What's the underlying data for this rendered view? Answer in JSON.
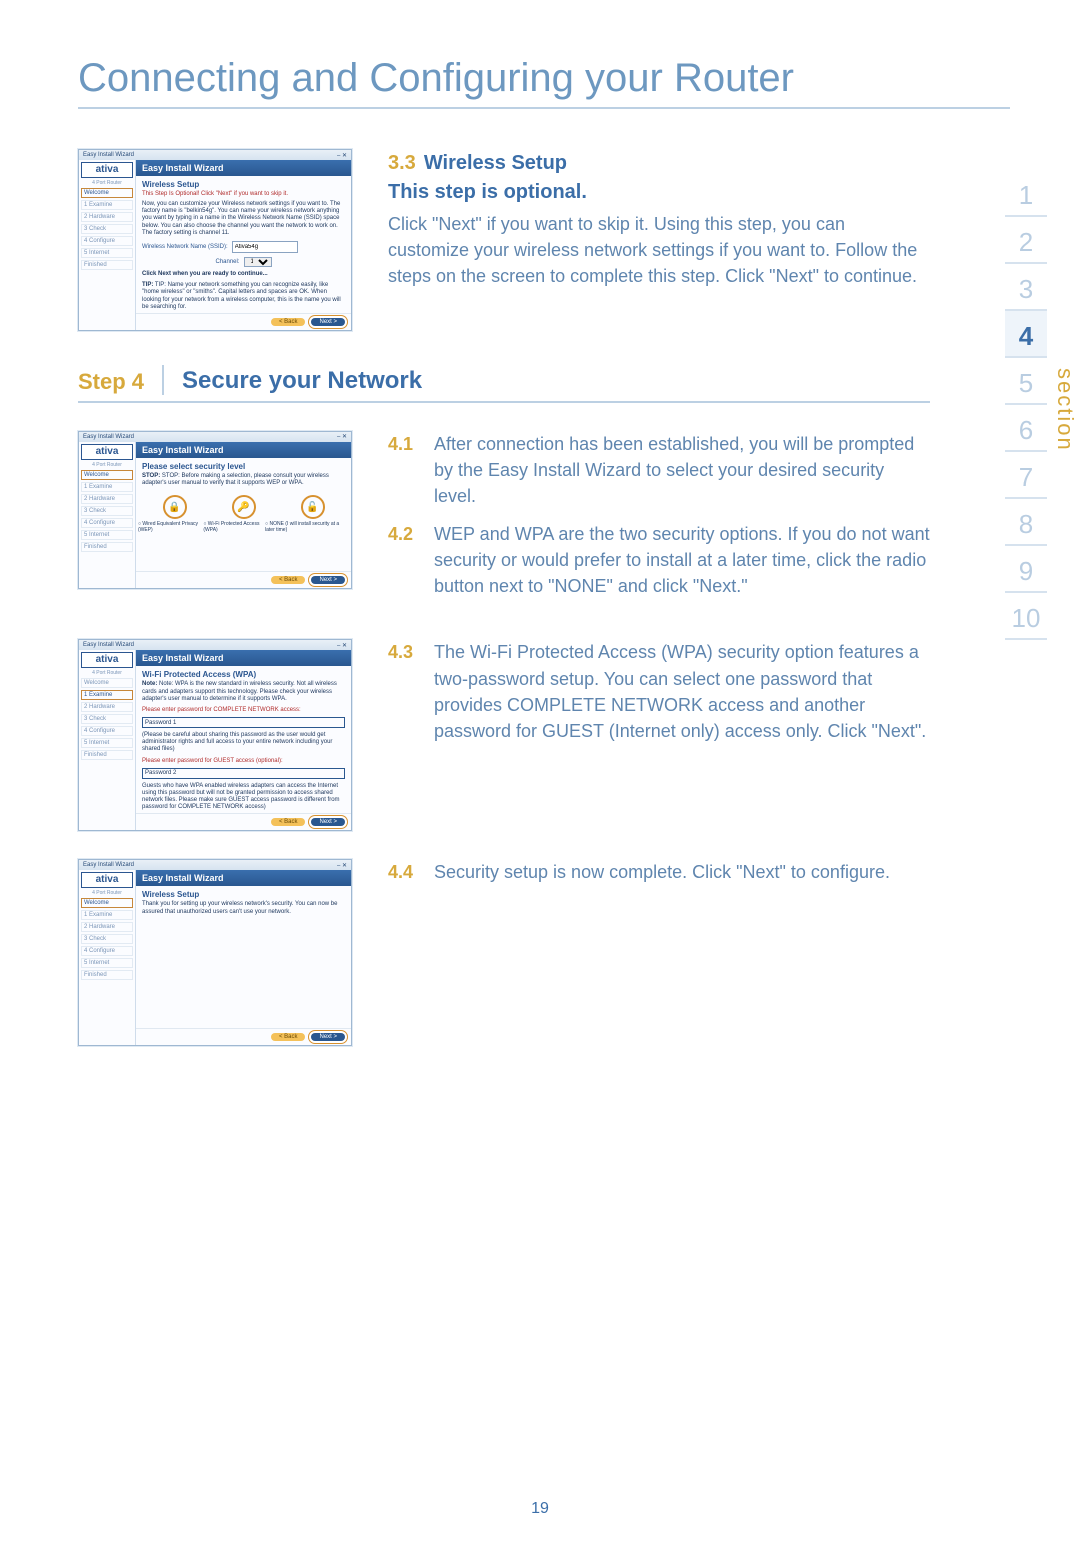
{
  "title": "Connecting and Configuring your Router",
  "page_number": "19",
  "section_label": "section",
  "section_numbers": [
    "1",
    "2",
    "3",
    "4",
    "5",
    "6",
    "7",
    "8",
    "9",
    "10"
  ],
  "section_active_index": 3,
  "wizard_common": {
    "titlebar": "Easy Install Wizard",
    "header": "Easy Install Wizard",
    "brand": "ativa",
    "product": "4 Port Router",
    "steps": [
      "Welcome",
      "1 Examine",
      "2 Hardware",
      "3 Check",
      "4 Configure",
      "5 Internet",
      "Finished"
    ],
    "back": "< Back",
    "next": "Next >"
  },
  "wiz33": {
    "active_step": "Welcome",
    "subtitle": "Wireless Setup",
    "red": "This Step Is Optional! Click \"Next\" if you want to skip it.",
    "para1": "Now, you can customize your Wireless network settings if you want to. The factory name is \"belkin54g\". You can name your wireless network anything you want by typing in a name in the Wireless Network Name (SSID) space below. You can also choose the channel you want the network to work on. The factory setting is channel 11.",
    "field1_label": "Wireless Network Name (SSID):",
    "field1_value": "Ativa54g",
    "field2_label": "Channel:",
    "field2_value": "11",
    "confirm": "Click Next when you are ready to continue...",
    "tip": "TIP: Name your network something you can recognize easily, like \"home wireless\" or \"smiths\". Capital letters and spaces are OK. When looking for your network from a wireless computer, this is the name you will be searching for."
  },
  "wiz41": {
    "active_step": "Welcome",
    "subtitle": "Please select security level",
    "stop": "STOP: Before making a selection, please consult your wireless adapter's user manual to verify that it supports WEP or WPA.",
    "opt1": "Wired Equivalent Privacy (WEP)",
    "opt2": "Wi-Fi Protected Access (WPA)",
    "opt3": "NONE (I will install security at a later time)"
  },
  "wiz43": {
    "active_step": "1 Examine",
    "subtitle": "Wi-Fi Protected Access (WPA)",
    "note": "Note: WPA is the new standard in wireless security.  Not all wireless cards and adapters support this technology.  Please check your wireless adapter's user manual to determine if it supports WPA.",
    "l1": "Please enter password for COMPLETE NETWORK access:",
    "p1": "Password 1",
    "p1b": "(Please be careful about sharing this password as the user would get administrator rights and full access to your entire network including your shared files)",
    "l2": "Please enter password for GUEST access (optional):",
    "p2": "Password 2",
    "p2b": "Guests who have WPA enabled wireless adapters can access the Internet using this password but will not be granted permission to access shared network files. Please make sure GUEST access password is different from password for COMPLETE NETWORK access)"
  },
  "wiz44": {
    "active_step": "Welcome",
    "subtitle": "Wireless Setup",
    "msg": "Thank you for setting up your wireless network's security.  You can now be assured that unauthorized users can't use your network."
  },
  "t33": {
    "num": "3.3",
    "h": "Wireless Setup",
    "sub": "This step is optional.",
    "p": "Click \"Next\" if you want to skip it. Using this step, you can customize your wireless network settings if you want to. Follow the steps on the screen to complete this step. Click \"Next\" to continue."
  },
  "step4": {
    "label": "Step 4",
    "title": "Secure your Network"
  },
  "i41": {
    "n": "4.1",
    "t": "After connection has been established, you will be prompted by the Easy Install Wizard to select your desired security level."
  },
  "i42": {
    "n": "4.2",
    "t": "WEP and WPA are the two security options. If you do not want security or would prefer to install at a later time, click the radio button next to \"NONE\" and click \"Next.\""
  },
  "i43": {
    "n": "4.3",
    "t": "The Wi-Fi Protected Access (WPA) security option features a two-password setup. You can select one password that provides COMPLETE NETWORK access and another password for GUEST (Internet only) access only. Click \"Next\"."
  },
  "i44": {
    "n": "4.4",
    "t": "Security setup is now complete. Click \"Next\" to configure."
  }
}
